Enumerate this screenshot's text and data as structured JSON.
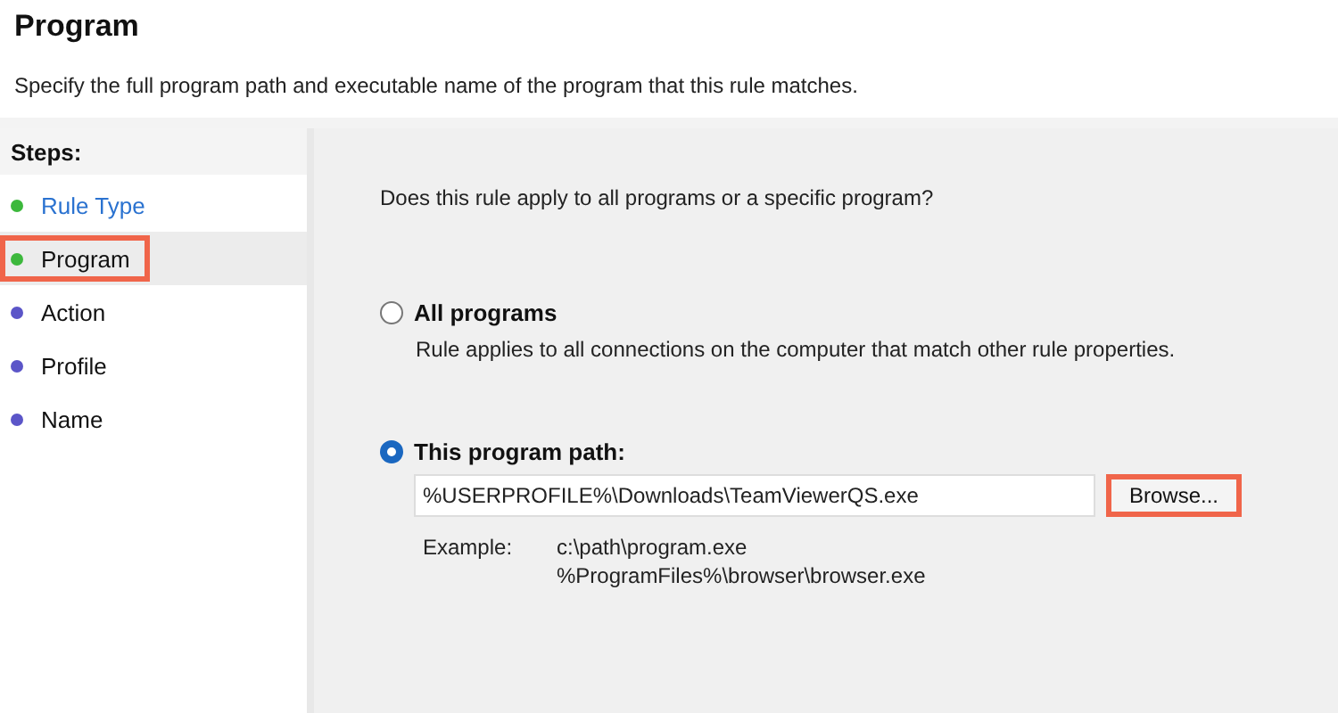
{
  "header": {
    "title": "Program",
    "subtitle": "Specify the full program path and executable name of the program that this rule matches."
  },
  "steps": {
    "heading": "Steps:",
    "items": [
      {
        "label": "Rule Type",
        "completed": true,
        "selected": false,
        "highlighted": false,
        "color": "#3cb83c"
      },
      {
        "label": "Program",
        "completed": false,
        "selected": true,
        "highlighted": true,
        "color": "#3cb83c"
      },
      {
        "label": "Action",
        "completed": false,
        "selected": false,
        "highlighted": false,
        "color": "#5b55c8"
      },
      {
        "label": "Profile",
        "completed": false,
        "selected": false,
        "highlighted": false,
        "color": "#5b55c8"
      },
      {
        "label": "Name",
        "completed": false,
        "selected": false,
        "highlighted": false,
        "color": "#5b55c8"
      }
    ]
  },
  "question": "Does this rule apply to all programs or a specific program?",
  "options": [
    {
      "label": "All programs",
      "description": "Rule applies to all connections on the computer that match other rule properties.",
      "selected": false
    },
    {
      "label": "This program path:",
      "selected": true
    }
  ],
  "path_field": {
    "value": "%USERPROFILE%\\Downloads\\TeamViewerQS.exe"
  },
  "browse_button": {
    "label": "Browse...",
    "highlighted": true
  },
  "example": {
    "label": "Example:",
    "lines": [
      "c:\\path\\program.exe",
      "%ProgramFiles%\\browser\\browser.exe"
    ]
  }
}
